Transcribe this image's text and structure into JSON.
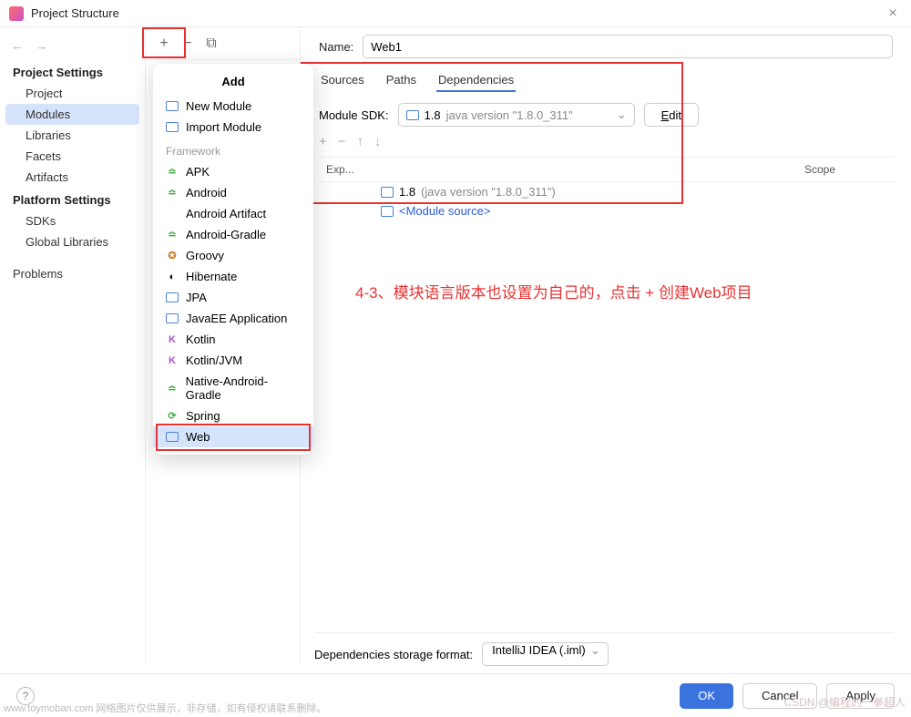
{
  "title": "Project Structure",
  "sidebar": {
    "back_icon": "←",
    "fwd_icon": "→",
    "section1": "Project Settings",
    "items1": [
      "Project",
      "Modules",
      "Libraries",
      "Facets",
      "Artifacts"
    ],
    "section2": "Platform Settings",
    "items2": [
      "SDKs",
      "Global Libraries"
    ],
    "problems": "Problems"
  },
  "toolbar": {
    "plus": "+",
    "minus": "−",
    "copy": "⧉"
  },
  "popup": {
    "title": "Add",
    "top": [
      {
        "label": "New Module",
        "icon": "folder"
      },
      {
        "label": "Import Module",
        "icon": "folder"
      }
    ],
    "section": "Framework",
    "frameworks": [
      {
        "label": "APK",
        "icon": "green"
      },
      {
        "label": "Android",
        "icon": "green"
      },
      {
        "label": "Android Artifact",
        "icon": "",
        "indent": true
      },
      {
        "label": "Android-Gradle",
        "icon": "green"
      },
      {
        "label": "Groovy",
        "icon": "orange"
      },
      {
        "label": "Hibernate",
        "icon": "hib"
      },
      {
        "label": "JPA",
        "icon": "folder"
      },
      {
        "label": "JavaEE Application",
        "icon": "folder"
      },
      {
        "label": "Kotlin",
        "icon": "purple"
      },
      {
        "label": "Kotlin/JVM",
        "icon": "purple"
      },
      {
        "label": "Native-Android-Gradle",
        "icon": "green"
      },
      {
        "label": "Spring",
        "icon": "spring"
      },
      {
        "label": "Web",
        "icon": "folder",
        "sel": true
      }
    ]
  },
  "content": {
    "name_label": "Name:",
    "name_value": "Web1",
    "tabs": [
      "Sources",
      "Paths",
      "Dependencies"
    ],
    "active_tab": 2,
    "sdk_label": "Module SDK:",
    "sdk_main": "1.8",
    "sdk_ver": "java version \"1.8.0_311\"",
    "edit_label": "Edit",
    "dep_header_exp": "Exp...",
    "dep_header_scope": "Scope",
    "deps": [
      {
        "main": "1.8",
        "ver": "(java version \"1.8.0_311\")",
        "icon": "folder"
      },
      {
        "main": "<Module source>",
        "ver": "",
        "icon": "folder",
        "src": true
      }
    ],
    "annot": "4-3、模块语言版本也设置为自己的，点击 + 创建Web项目",
    "deps_format_label": "Dependencies storage format:",
    "deps_format_value": "IntelliJ IDEA (.iml)"
  },
  "footer": {
    "ok": "OK",
    "cancel": "Cancel",
    "apply": "Apply"
  },
  "watermark1": "www.toymoban.com 网络图片仅供展示，非存储，如有侵权请联系删除。",
  "watermark2": "CSDN @编程的一拳超人"
}
